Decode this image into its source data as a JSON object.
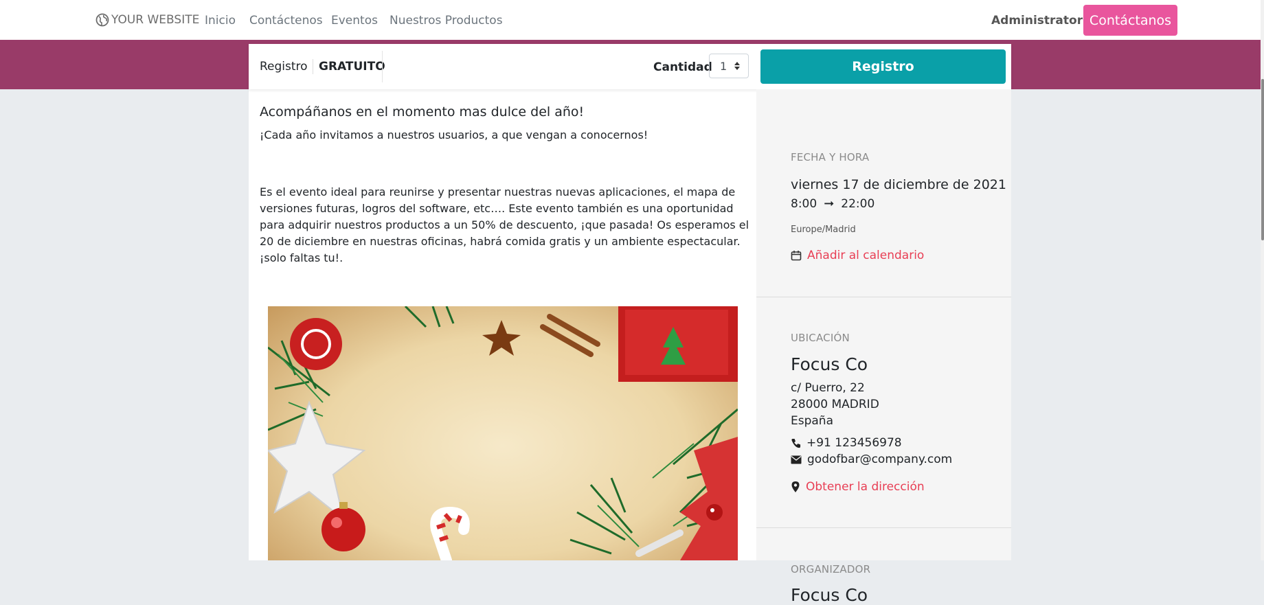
{
  "navbar": {
    "brand": "YOUR WEBSITE",
    "links": [
      "Inicio",
      "Contáctenos",
      "Eventos",
      "Nuestros Productos"
    ],
    "user": "Administrator",
    "cta": "Contáctanos"
  },
  "registration": {
    "label": "Registro",
    "price": "GRATUITO",
    "quantity_label": "Cantidad",
    "quantity_value": "1",
    "button": "Registro"
  },
  "event": {
    "headline": "Acompáñanos en el momento mas dulce del año!",
    "subtitle": "¡Cada año invitamos a nuestros usuarios, a que vengan a conocernos!",
    "description": "Es el evento ideal para reunirse y presentar nuestras nuevas aplicaciones, el mapa de versiones futuras, logros del software, etc…. Este evento también es una oportunidad para adquirir nuestros productos a un 50% de descuento, ¡que pasada! Os esperamos el 20 de diciembre en nuestras oficinas, habrá comida gratis  y un ambiente espectacular. ¡solo faltas tu!."
  },
  "sidebar": {
    "datetime": {
      "heading": "FECHA Y HORA",
      "date": "viernes 17 de diciembre de 2021",
      "start": "8:00",
      "end": "22:00",
      "timezone": "Europe/Madrid",
      "calendar_link": "Añadir al calendario"
    },
    "location": {
      "heading": "UBICACIÓN",
      "name": "Focus Co",
      "street": "c/ Puerro, 22",
      "city": "28000 MADRID",
      "country": "España",
      "phone": "+91 123456978",
      "email": "godofbar@company.com",
      "directions_link": "Obtener la dirección"
    },
    "organizer": {
      "heading": "ORGANIZADOR",
      "name": "Focus Co"
    }
  },
  "colors": {
    "brand_band": "#993b68",
    "cta_pink": "#e9559d",
    "register_teal": "#0aa0a8",
    "link_red": "#e83e54"
  }
}
